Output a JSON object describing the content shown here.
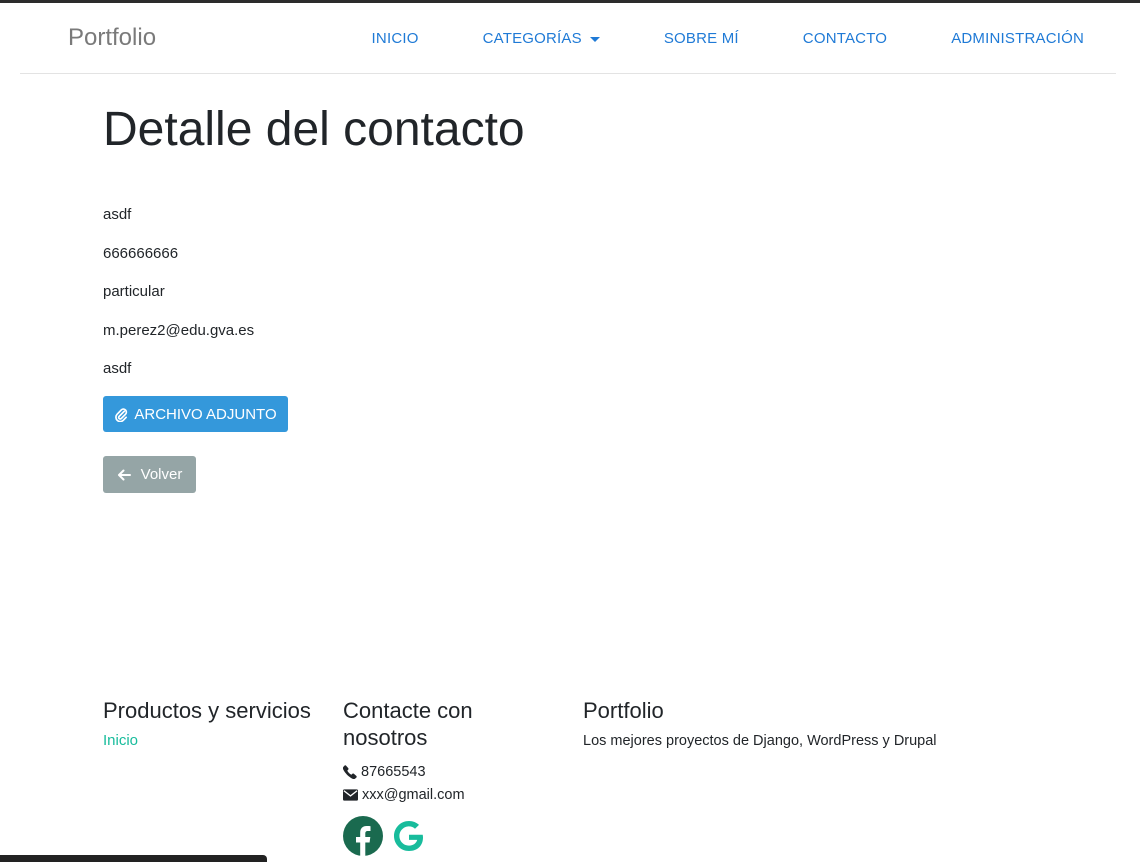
{
  "nav": {
    "brand": "Portfolio",
    "links": [
      "INICIO",
      "CATEGORÍAS",
      "SOBRE MÍ",
      "CONTACTO",
      "ADMINISTRACIÓN"
    ]
  },
  "page": {
    "title": "Detalle del contacto",
    "fields": [
      "asdf",
      "666666666",
      "particular",
      "m.perez2@edu.gva.es",
      "asdf"
    ],
    "attach_button": "ARCHIVO ADJUNTO",
    "back_button": "Volver"
  },
  "footer": {
    "products": {
      "title": "Productos y servicios",
      "link": "Inicio"
    },
    "contact": {
      "title": "Contacte con nosotros",
      "phone": "87665543",
      "email": "xxx@gmail.com"
    },
    "portfolio": {
      "title": "Portfolio",
      "description": "Los mejores proyectos de Django, WordPress y Drupal"
    }
  },
  "icons": {
    "attach": "paperclip-icon",
    "back": "arrow-left-icon",
    "phone": "phone-icon",
    "email": "envelope-icon",
    "facebook": "facebook-icon",
    "google": "google-icon",
    "dropdown": "caret-down-icon"
  },
  "colors": {
    "nav_link": "#1f7ad6",
    "attach_button": "#3498db",
    "back_button": "#95a5a6",
    "footer_link": "#18bc9c",
    "facebook": "#1a6a4f",
    "google": "#18bc9c"
  }
}
